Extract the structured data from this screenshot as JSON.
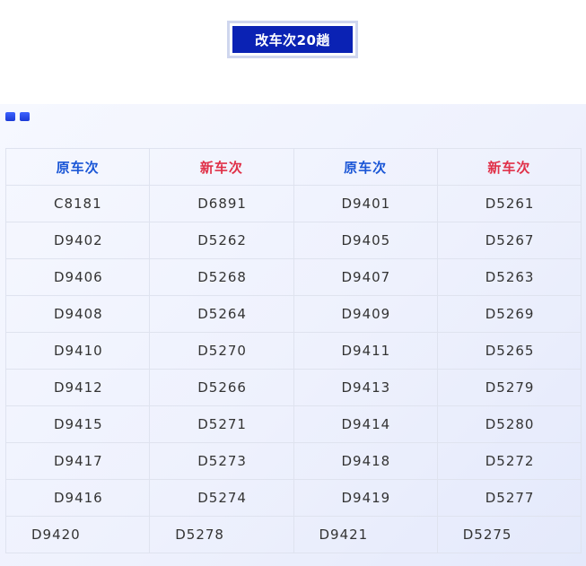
{
  "title": "改车次20趟",
  "table": {
    "headers": [
      "原车次",
      "新车次",
      "原车次",
      "新车次"
    ],
    "rows": [
      [
        "C8181",
        "D6891",
        "D9401",
        "D5261"
      ],
      [
        "D9402",
        "D5262",
        "D9405",
        "D5267"
      ],
      [
        "D9406",
        "D5268",
        "D9407",
        "D5263"
      ],
      [
        "D9408",
        "D5264",
        "D9409",
        "D5269"
      ],
      [
        "D9410",
        "D5270",
        "D9411",
        "D5265"
      ],
      [
        "D9412",
        "D5266",
        "D9413",
        "D5279"
      ],
      [
        "D9415",
        "D5271",
        "D9414",
        "D5280"
      ],
      [
        "D9417",
        "D5273",
        "D9418",
        "D5272"
      ],
      [
        "D9416",
        "D5274",
        "D9419",
        "D5277"
      ],
      [
        "D9420",
        "D5278",
        "D9421",
        "D5275"
      ]
    ]
  },
  "colors": {
    "title_bg": "#0a22b4",
    "original_header": "#1a56d6",
    "new_header": "#e03048"
  }
}
